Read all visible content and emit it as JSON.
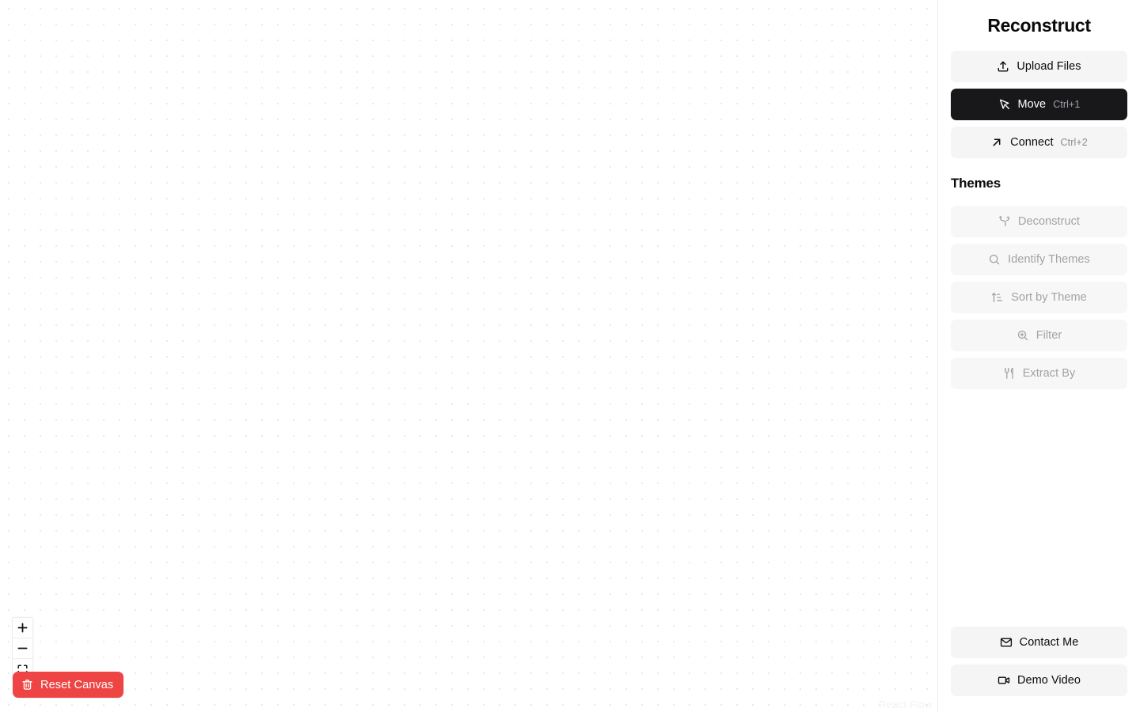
{
  "app": {
    "title": "Reconstruct",
    "watermark": "React Flow"
  },
  "canvas": {
    "zoom_in_label": "+",
    "zoom_out_label": "−",
    "fit_view_label": "Fit view",
    "reset": {
      "label": "Reset Canvas",
      "icon": "trash-icon",
      "color": "#ef4444"
    },
    "grid": {
      "type": "dots",
      "spacing": 20,
      "dot_color": "#e3e3e3"
    }
  },
  "sidebar": {
    "tools": [
      {
        "label": "Upload Files",
        "icon": "upload-icon",
        "shortcut": "",
        "state": "default"
      },
      {
        "label": "Move",
        "icon": "cursor-arrow-icon",
        "shortcut": "Ctrl+1",
        "state": "active"
      },
      {
        "label": "Connect",
        "icon": "arrow-up-right-icon",
        "shortcut": "Ctrl+2",
        "state": "default"
      }
    ],
    "themes_heading": "Themes",
    "theme_actions": [
      {
        "label": "Deconstruct",
        "icon": "git-branch-icon",
        "state": "disabled"
      },
      {
        "label": "Identify Themes",
        "icon": "search-icon",
        "state": "disabled"
      },
      {
        "label": "Sort by Theme",
        "icon": "sort-ascending-icon",
        "state": "disabled"
      },
      {
        "label": "Filter",
        "icon": "zoom-in-icon",
        "state": "disabled"
      },
      {
        "label": "Extract By",
        "icon": "utensils-icon",
        "state": "disabled"
      }
    ],
    "footer_actions": [
      {
        "label": "Contact Me",
        "icon": "mail-icon",
        "state": "default"
      },
      {
        "label": "Demo Video",
        "icon": "video-icon",
        "state": "default"
      }
    ]
  },
  "colors": {
    "accent_danger": "#ef4444",
    "active_bg": "#18181b",
    "button_bg": "#f5f5f5",
    "disabled_text": "#a3a3a3"
  }
}
